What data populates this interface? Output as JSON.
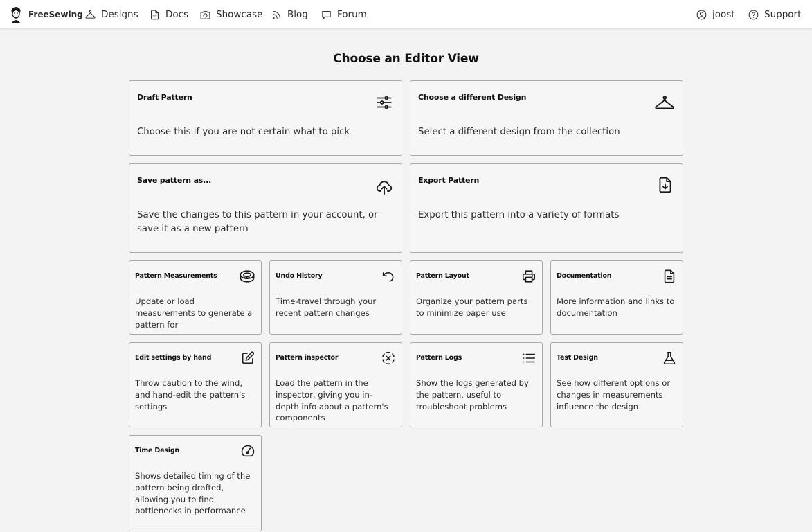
{
  "nav": {
    "brand": "FreeSewing",
    "items": [
      {
        "label": "Designs",
        "icon": "hanger-icon"
      },
      {
        "label": "Docs",
        "icon": "document-icon"
      },
      {
        "label": "Showcase",
        "icon": "camera-icon"
      },
      {
        "label": "Blog",
        "icon": "rss-icon"
      },
      {
        "label": "Forum",
        "icon": "chat-bubble-icon"
      }
    ],
    "right": [
      {
        "label": "joost",
        "icon": "user-circle-icon"
      },
      {
        "label": "Support",
        "icon": "help-circle-icon"
      }
    ]
  },
  "page": {
    "title": "Choose an Editor View"
  },
  "views": [
    {
      "title": "Draft Pattern",
      "description": "Choose this if you are not certain what to pick",
      "icon": "sliders-icon"
    },
    {
      "title": "Choose a different Design",
      "description": "Select a different design from the collection",
      "icon": "hanger-icon"
    },
    {
      "title": "Save pattern as...",
      "description": "Save the changes to this pattern in your account, or save it as a new pattern",
      "icon": "cloud-upload-icon"
    },
    {
      "title": "Export Pattern",
      "description": "Export this pattern into a variety of formats",
      "icon": "file-download-icon"
    },
    {
      "title": "Pattern Measurements",
      "description": "Update or load measurements to generate a pattern for",
      "icon": "measuring-tape-icon"
    },
    {
      "title": "Undo History",
      "description": "Time-travel through your recent pattern changes",
      "icon": "undo-icon"
    },
    {
      "title": "Pattern Layout",
      "description": "Organize your pattern parts to minimize paper use",
      "icon": "printer-icon"
    },
    {
      "title": "Documentation",
      "description": "More information and links to documentation",
      "icon": "document-icon"
    },
    {
      "title": "Edit settings by hand",
      "description": "Throw caution to the wind, and hand-edit the pattern's settings",
      "icon": "edit-icon"
    },
    {
      "title": "Pattern inspector",
      "description": "Load the pattern in the inspector, giving you in-depth info about a pattern's components",
      "icon": "inspect-icon"
    },
    {
      "title": "Pattern Logs",
      "description": "Show the logs generated by the pattern, useful to troubleshoot problems",
      "icon": "list-icon"
    },
    {
      "title": "Test Design",
      "description": "See how different options or changes in measurements influence the design",
      "icon": "flask-icon"
    },
    {
      "title": "Time Design",
      "description": "Shows detailed timing of the pattern being drafted, allowing you to find bottlenecks in performance",
      "icon": "speedometer-icon"
    }
  ]
}
